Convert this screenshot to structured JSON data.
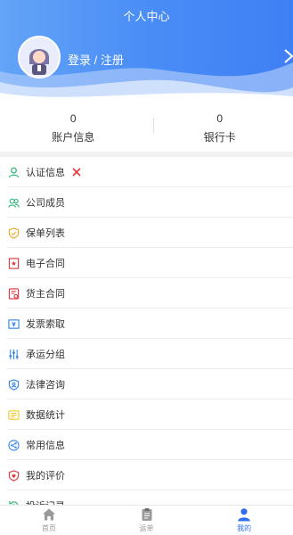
{
  "header": {
    "title": "个人中心",
    "login_text": "登录 / 注册"
  },
  "stats": [
    {
      "value": "0",
      "label": "账户信息"
    },
    {
      "value": "0",
      "label": "银行卡"
    }
  ],
  "menu": [
    {
      "label": "认证信息",
      "icon": "user-icon",
      "color": "#2bb673"
    },
    {
      "label": "公司成员",
      "icon": "users-icon",
      "color": "#2bb673"
    },
    {
      "label": "保单列表",
      "icon": "shield-icon",
      "color": "#f5a623"
    },
    {
      "label": "电子合同",
      "icon": "contract-icon",
      "color": "#e0353b"
    },
    {
      "label": "货主合同",
      "icon": "owner-contract-icon",
      "color": "#e0353b"
    },
    {
      "label": "发票索取",
      "icon": "invoice-icon",
      "color": "#2f80ed"
    },
    {
      "label": "承运分组",
      "icon": "group-icon",
      "color": "#2f80ed"
    },
    {
      "label": "法律咨询",
      "icon": "law-icon",
      "color": "#2f80ed"
    },
    {
      "label": "数据统计",
      "icon": "stats-icon",
      "color": "#f5c623"
    },
    {
      "label": "常用信息",
      "icon": "share-icon",
      "color": "#2f80ed"
    },
    {
      "label": "我的评价",
      "icon": "review-icon",
      "color": "#e0353b"
    },
    {
      "label": "投诉记录",
      "icon": "complaint-icon",
      "color": "#2bb673"
    }
  ],
  "tabs": [
    {
      "label": "首页",
      "icon": "home-icon"
    },
    {
      "label": "运单",
      "icon": "clipboard-icon"
    },
    {
      "label": "我的",
      "icon": "person-icon"
    }
  ],
  "colors": {
    "primary": "#3f7ff4",
    "tab_active": "#2f6cf0",
    "unverified_x": "#e0353b"
  }
}
